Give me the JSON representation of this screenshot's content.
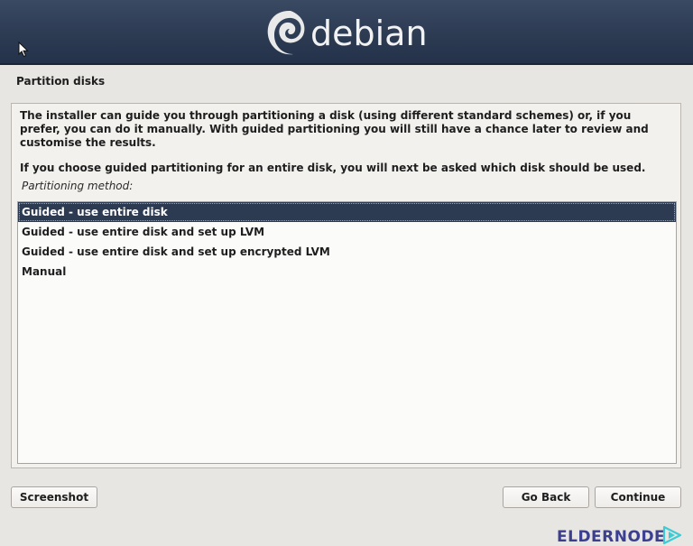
{
  "header": {
    "logo_text": "debian",
    "logo_icon": "debian-swirl-icon",
    "background": "#2c3a52"
  },
  "step": {
    "title": "Partition disks"
  },
  "panel": {
    "description_1": "The installer can guide you through partitioning a disk (using different standard schemes) or, if you prefer, you can do it manually. With guided partitioning you will still have a chance later to review and customise the results.",
    "description_2": "If you choose guided partitioning for an entire disk, you will next be asked which disk should be used.",
    "method_label": "Partitioning method:",
    "options": [
      "Guided - use entire disk",
      "Guided - use entire disk and set up LVM",
      "Guided - use entire disk and set up encrypted LVM",
      "Manual"
    ],
    "selected_index": 0,
    "selection_color": "#2c3a52"
  },
  "watermark": {
    "text": "ELDERNODE",
    "accent": "#3ecbd4"
  },
  "buttons": {
    "screenshot": "Screenshot",
    "go_back": "Go Back",
    "continue": "Continue"
  }
}
